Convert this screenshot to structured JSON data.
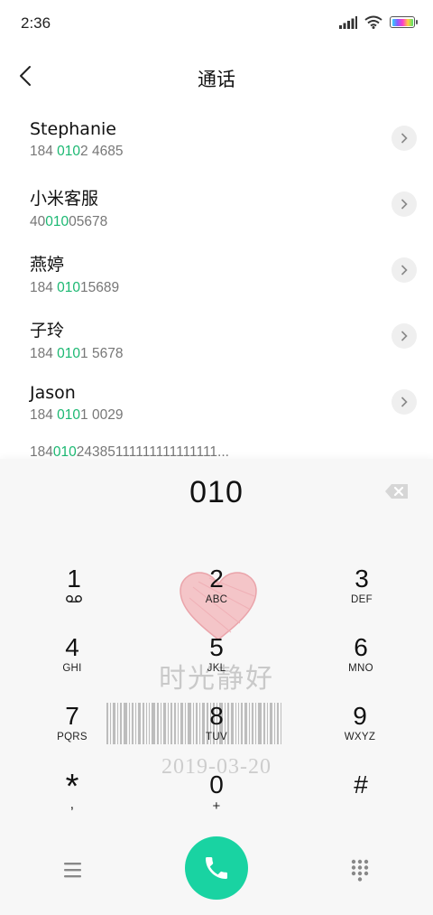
{
  "status_bar": {
    "time": "2:36",
    "battery_colors": [
      "#2fd0ff",
      "#8a5cff",
      "#ff3ec8",
      "#ffd23e",
      "#56e36a"
    ]
  },
  "header": {
    "title": "通话",
    "back_icon": "chevron-left-icon"
  },
  "query": "010",
  "highlight_color": "#1bb872",
  "contacts": [
    {
      "name": "Stephanie",
      "num_pre": "184 ",
      "num_hl": "010",
      "num_post": "2 4685"
    },
    {
      "name": "小米客服",
      "num_pre": "40",
      "num_hl": "010",
      "num_post": "05678"
    },
    {
      "name": "燕婷",
      "num_pre": "184 ",
      "num_hl": "010",
      "num_post": "15689"
    },
    {
      "name": "子玲",
      "num_pre": "184 ",
      "num_hl": "010",
      "num_post": "1 5678"
    },
    {
      "name": "Jason",
      "num_pre": "184 ",
      "num_hl": "010",
      "num_post": "1 0029"
    }
  ],
  "partial_contact": {
    "num_pre": "184",
    "num_hl": "010",
    "num_post": "24385111111111111111..."
  },
  "dialpad": {
    "display": "010",
    "watermark_text": "时光静好",
    "watermark_date": "2019-03-20",
    "keys": [
      {
        "digit": "1",
        "letters": "voicemail-icon"
      },
      {
        "digit": "2",
        "letters": "ABC"
      },
      {
        "digit": "3",
        "letters": "DEF"
      },
      {
        "digit": "4",
        "letters": "GHI"
      },
      {
        "digit": "5",
        "letters": "JKL"
      },
      {
        "digit": "6",
        "letters": "MNO"
      },
      {
        "digit": "7",
        "letters": "PQRS"
      },
      {
        "digit": "8",
        "letters": "TUV"
      },
      {
        "digit": "9",
        "letters": "WXYZ"
      },
      {
        "digit": "*",
        "letters": ","
      },
      {
        "digit": "0",
        "letters": "+"
      },
      {
        "digit": "#",
        "letters": ""
      }
    ],
    "call_color": "#19d3a2"
  }
}
